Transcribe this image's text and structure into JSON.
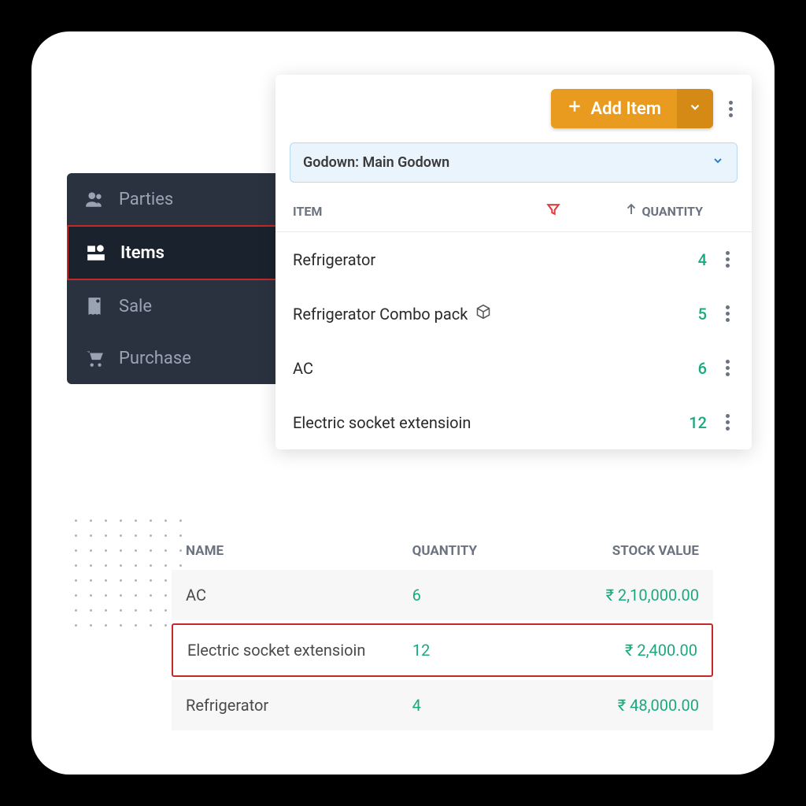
{
  "sidebar": {
    "items": [
      {
        "label": "Parties"
      },
      {
        "label": "Items"
      },
      {
        "label": "Sale"
      },
      {
        "label": "Purchase"
      }
    ]
  },
  "panel": {
    "add_label": "Add Item",
    "godown_label": "Godown: Main Godown",
    "columns": {
      "item": "ITEM",
      "quantity": "QUANTITY"
    },
    "rows": [
      {
        "name": "Refrigerator",
        "qty": "4",
        "combo": false
      },
      {
        "name": "Refrigerator Combo pack",
        "qty": "5",
        "combo": true
      },
      {
        "name": "AC",
        "qty": "6",
        "combo": false
      },
      {
        "name": "Electric socket extensioin",
        "qty": "12",
        "combo": false
      }
    ]
  },
  "stock": {
    "columns": {
      "name": "NAME",
      "quantity": "QUANTITY",
      "value": "STOCK VALUE"
    },
    "rows": [
      {
        "name": "AC",
        "qty": "6",
        "value": "₹ 2,10,000.00",
        "highlight": false
      },
      {
        "name": "Electric socket extensioin",
        "qty": "12",
        "value": "₹ 2,400.00",
        "highlight": true
      },
      {
        "name": "Refrigerator",
        "qty": "4",
        "value": "₹ 48,000.00",
        "highlight": false
      }
    ]
  }
}
